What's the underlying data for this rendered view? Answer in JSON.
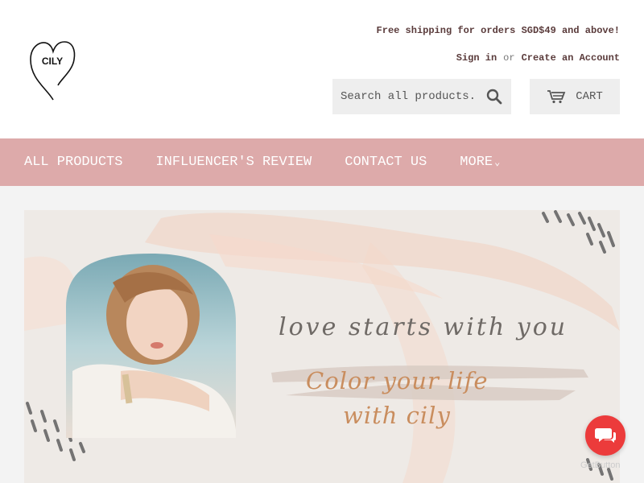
{
  "brand": {
    "logo_text": "CILY"
  },
  "header": {
    "promo": "Free shipping for orders SGD$49 and above!",
    "sign_in": "Sign in",
    "or": "or",
    "create_account": "Create an Account",
    "search_placeholder": "Search all products...",
    "search_icon": "search-icon",
    "cart_label": "CART",
    "cart_icon": "cart-icon"
  },
  "nav": {
    "items": [
      {
        "label": "ALL PRODUCTS"
      },
      {
        "label": "INFLUENCER'S REVIEW"
      },
      {
        "label": "CONTACT US"
      },
      {
        "label": "MORE"
      }
    ]
  },
  "banner": {
    "tagline": "love starts with you",
    "line1": "Color your life",
    "line2": "with cily"
  },
  "widget": {
    "chat_icon": "chat-bubbles-icon",
    "label": "GetButton",
    "color": "#ec3b3b"
  },
  "colors": {
    "nav_bg": "#ddaaaa",
    "accent_text": "#5a3b3b",
    "banner_brush": "#c98d5e"
  }
}
